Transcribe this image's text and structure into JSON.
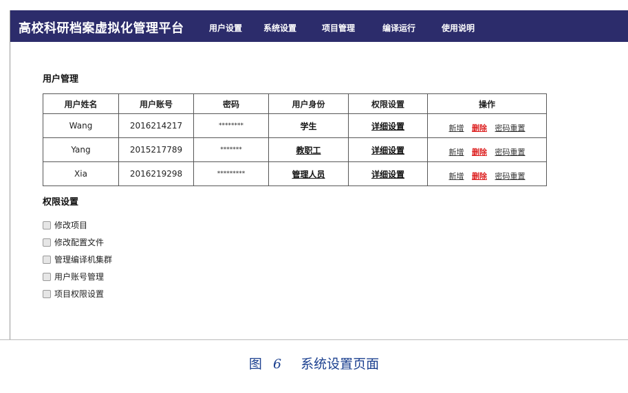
{
  "app": {
    "title": "高校科研档案虚拟化管理平台",
    "nav": [
      "用户设置",
      "系统设置",
      "项目管理",
      "编译运行",
      "使用说明"
    ]
  },
  "user_management": {
    "heading": "用户管理",
    "columns": [
      "用户姓名",
      "用户账号",
      "密码",
      "用户身份",
      "权限设置",
      "操作"
    ],
    "rows": [
      {
        "name": "Wang",
        "account": "2016214217",
        "password": "********",
        "role": "学生",
        "perm": "详细设置"
      },
      {
        "name": "Yang",
        "account": "2015217789",
        "password": "*******",
        "role": "教职工",
        "perm": "详细设置"
      },
      {
        "name": "Xia",
        "account": "2016219298",
        "password": "*********",
        "role": "管理人员",
        "perm": "详细设置"
      }
    ],
    "ops": {
      "add": "新增",
      "delete": "删除",
      "reset": "密码重置"
    }
  },
  "permissions": {
    "heading": "权限设置",
    "items": [
      "修改项目",
      "修改配置文件",
      "管理编译机集群",
      "用户账号管理",
      "项目权限设置"
    ]
  },
  "caption": {
    "label": "图",
    "number": "6",
    "text": "系统设置页面"
  },
  "colors": {
    "topbar": "#2c2c6b",
    "delete": "#dd2222",
    "caption": "#1a3f8f"
  }
}
